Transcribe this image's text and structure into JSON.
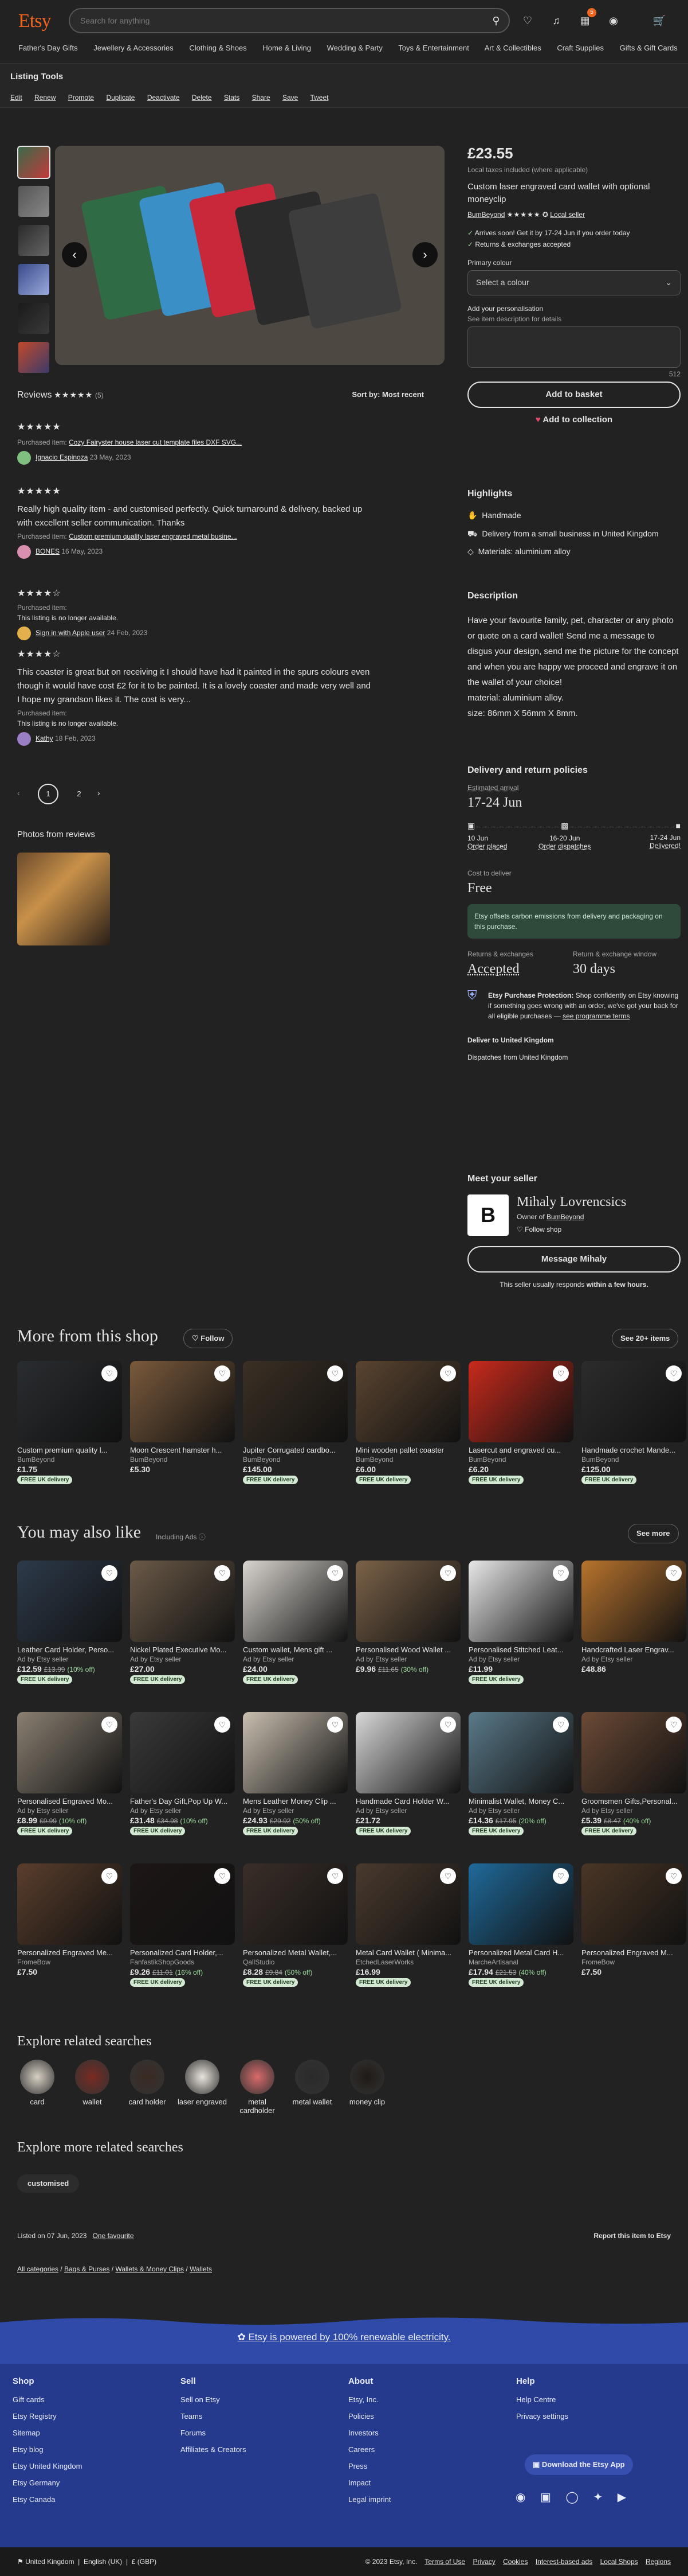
{
  "header": {
    "logo": "Etsy",
    "search_placeholder": "Search for anything",
    "cart_count": "5",
    "categories": [
      "Father's Day Gifts",
      "Jewellery & Accessories",
      "Clothing & Shoes",
      "Home & Living",
      "Wedding & Party",
      "Toys & Entertainment",
      "Art & Collectibles",
      "Craft Supplies",
      "Gifts & Gift Cards"
    ]
  },
  "tools": {
    "title": "Listing Tools",
    "actions": [
      "Edit",
      "Renew",
      "Promote",
      "Duplicate",
      "Deactivate",
      "Delete",
      "Stats",
      "Share",
      "Save",
      "Tweet"
    ]
  },
  "reviews": {
    "title": "Reviews",
    "count": "(5)",
    "sort_label": "Sort by: Most recent",
    "items": [
      {
        "stars": "★★★★★",
        "purchased_label": "Purchased item:",
        "item": "Cozy Fairyster house laser cut template files DXF SVG...",
        "author": "Ignacio Espinoza",
        "date": "23 May, 2023",
        "body": "",
        "avatar_color": "#7fbf7f"
      },
      {
        "stars": "★★★★★",
        "purchased_label": "Purchased item:",
        "item": "Custom premium quality laser engraved metal busine...",
        "author": "BONES",
        "date": "16 May, 2023",
        "body": "Really high quality item - and customised perfectly. Quick turnaround & delivery, backed up with excellent seller communication. Thanks",
        "avatar_color": "#d88fb0"
      },
      {
        "stars": "★★★★☆",
        "purchased_label": "Purchased item:",
        "item": "This listing is no longer available.",
        "author": "Sign in with Apple user",
        "date": "24 Feb, 2023",
        "body": "",
        "avatar_color": "#e3b04b"
      },
      {
        "stars": "★★★★☆",
        "purchased_label": "Purchased item:",
        "item": "This listing is no longer available.",
        "author": "Kathy",
        "date": "18 Feb, 2023",
        "body": "This coaster is great but on receiving it I should have had it painted in the spurs colours even though it would have cost £2 for it to be painted. It is a lovely coaster and made very well and I hope my grandson likes it. The cost is very...",
        "avatar_color": "#9a7fc4"
      }
    ],
    "pages": [
      "1",
      "2"
    ],
    "photos_title": "Photos from reviews"
  },
  "listing": {
    "price": "£23.55",
    "tax_note": "Local taxes included (where applicable)",
    "title": "Custom laser engraved card wallet with optional moneyclip",
    "shop": "BumBeyond",
    "stars": "★★★★★",
    "star_badge": "✪",
    "local_seller": "Local seller",
    "arrival": "Arrives soon! Get it by 17-24 Jun if you order today",
    "returns": "Returns & exchanges accepted",
    "option_label": "Primary colour",
    "option_value": "Select a colour",
    "personal_label": "Add your personalisation",
    "personal_hint": "See item description for details",
    "counter": "512",
    "add_basket": "Add to basket",
    "add_collection": "Add to collection"
  },
  "highlights": {
    "title": "Highlights",
    "items": [
      "Handmade",
      "Delivery from a small business in United Kingdom",
      "Materials: aluminium alloy"
    ]
  },
  "description": {
    "title": "Description",
    "text": "Have your favourite family, pet, character or any photo or quote on a card wallet! Send me a message to disgus your design, send me the picture for the concept and when you are happy we proceed and engrave it on the wallet of your choice!\nmaterial: aluminium alloy.\nsize: 86mm X 56mm X 8mm."
  },
  "delivery": {
    "title": "Delivery and return policies",
    "est_label": "Estimated arrival",
    "est": "17-24 Jun",
    "steps": [
      {
        "date": "10 Jun",
        "label": "Order placed"
      },
      {
        "date": "16-20 Jun",
        "label": "Order dispatches"
      },
      {
        "date": "17-24 Jun",
        "label": "Delivered!"
      }
    ],
    "cost_label": "Cost to deliver",
    "cost": "Free",
    "eco": "Etsy offsets carbon emissions from delivery and packaging on this purchase.",
    "re_label": "Returns & exchanges",
    "re_value": "Accepted",
    "window_label": "Return & exchange window",
    "window_value": "30 days",
    "protect_title": "Etsy Purchase Protection:",
    "protect_text": " Shop confidently on Etsy knowing if something goes wrong with an order, we've got your back for all eligible purchases —",
    "protect_link": "see programme terms",
    "deliver_to": "Deliver to United Kingdom",
    "dispatch_from": "Dispatches from United Kingdom"
  },
  "seller": {
    "title": "Meet your seller",
    "name": "Mihaly Lovrencsics",
    "owner_of": "Owner of",
    "shop": "BumBeyond",
    "follow": "Follow shop",
    "message": "Message Mihaly",
    "response": "This seller usually responds ",
    "response_bold": "within a few hours."
  },
  "more_shop": {
    "title": "More from this shop",
    "follow": "Follow",
    "see": "See 20+ items",
    "items": [
      {
        "title": "Custom premium quality l...",
        "shop": "BumBeyond",
        "price": "£1.75",
        "free": "FREE UK delivery",
        "color": "#2a2d30"
      },
      {
        "title": "Moon Crescent hamster h...",
        "shop": "BumBeyond",
        "price": "£5.30",
        "free": "",
        "color": "#7a5a3c"
      },
      {
        "title": "Jupiter Corrugated cardbo...",
        "shop": "BumBeyond",
        "price": "£145.00",
        "free": "FREE UK delivery",
        "color": "#3b3024"
      },
      {
        "title": "Mini wooden pallet coaster",
        "shop": "BumBeyond",
        "price": "£6.00",
        "free": "FREE UK delivery",
        "color": "#5a4430"
      },
      {
        "title": "Lasercut and engraved cu...",
        "shop": "BumBeyond",
        "price": "£6.20",
        "free": "FREE UK delivery",
        "color": "#c82a1c"
      },
      {
        "title": "Handmade crochet Mande...",
        "shop": "BumBeyond",
        "price": "£125.00",
        "free": "FREE UK delivery",
        "color": "#2c2c2c"
      }
    ]
  },
  "also_like": {
    "title": "You may also like",
    "ads_label": "Including Ads",
    "more": "See more",
    "items": [
      {
        "title": "Leather Card Holder, Perso...",
        "shop": "Ad by Etsy seller",
        "price": "£12.59",
        "was": "£13.99",
        "off": "(10% off)",
        "free": "FREE UK delivery",
        "color": "#2d3a4a"
      },
      {
        "title": "Nickel Plated Executive Mo...",
        "shop": "Ad by Etsy seller",
        "price": "£27.00",
        "was": "",
        "off": "",
        "free": "FREE UK delivery",
        "color": "#6b5a48"
      },
      {
        "title": "Custom wallet, Mens gift ...",
        "shop": "Ad by Etsy seller",
        "price": "£24.00",
        "was": "",
        "off": "",
        "free": "FREE UK delivery",
        "color": "#d9d5cf"
      },
      {
        "title": "Personalised Wood Wallet ...",
        "shop": "Ad by Etsy seller",
        "price": "£9.96",
        "was": "£11.65",
        "off": "(30% off)",
        "free": "",
        "color": "#7b6248"
      },
      {
        "title": "Personalised Stitched Leat...",
        "shop": "Ad by Etsy seller",
        "price": "£11.99",
        "was": "",
        "off": "",
        "free": "FREE UK delivery",
        "color": "#e8e8e8"
      },
      {
        "title": "Handcrafted Laser Engrav...",
        "shop": "Ad by Etsy seller",
        "price": "£48.86",
        "was": "",
        "off": "",
        "free": "",
        "color": "#b8742e"
      },
      {
        "title": "Personalised Engraved Mo...",
        "shop": "Ad by Etsy seller",
        "price": "£8.99",
        "was": "£9.99",
        "off": "(10% off)",
        "free": "FREE UK delivery",
        "color": "#8a8072"
      },
      {
        "title": "Father's Day Gift,Pop Up W...",
        "shop": "Ad by Etsy seller",
        "price": "£31.48",
        "was": "£34.98",
        "off": "(10% off)",
        "free": "FREE UK delivery",
        "color": "#3a3a3a"
      },
      {
        "title": "Mens Leather Money Clip ...",
        "shop": "Ad by Etsy seller",
        "price": "£24.93",
        "was": "£29.92",
        "off": "(50% off)",
        "free": "FREE UK delivery",
        "color": "#c9bfb0"
      },
      {
        "title": "Handmade Card Holder W...",
        "shop": "Ad by Etsy seller",
        "price": "£21.72",
        "was": "",
        "off": "",
        "free": "FREE UK delivery",
        "color": "#d8d8d8"
      },
      {
        "title": "Minimalist Wallet, Money C...",
        "shop": "Ad by Etsy seller",
        "price": "£14.36",
        "was": "£17.95",
        "off": "(20% off)",
        "free": "FREE UK delivery",
        "color": "#5a7a8a"
      },
      {
        "title": "Groomsmen Gifts,Personal...",
        "shop": "Ad by Etsy seller",
        "price": "£5.39",
        "was": "£8.47",
        "off": "(40% off)",
        "free": "FREE UK delivery",
        "color": "#6b4a36"
      },
      {
        "title": "Personalized Engraved Me...",
        "shop": "FromeBow",
        "price": "£7.50",
        "was": "",
        "off": "",
        "free": "",
        "color": "#5a3e2c"
      },
      {
        "title": "Personalized Card Holder,...",
        "shop": "FanfastikShopGoods",
        "price": "£9.26",
        "was": "£11.01",
        "off": "(16% off)",
        "free": "FREE UK delivery",
        "color": "#1d1616"
      },
      {
        "title": "Personalized Metal Wallet,...",
        "shop": "QallStudio",
        "price": "£8.28",
        "was": "£9.84",
        "off": "(50% off)",
        "free": "FREE UK delivery",
        "color": "#3a2e28"
      },
      {
        "title": "Metal Card Wallet ( Minima...",
        "shop": "EtchedLaserWorks",
        "price": "£16.99",
        "was": "",
        "off": "",
        "free": "FREE UK delivery",
        "color": "#4a3a2e"
      },
      {
        "title": "Personalized Metal Card H...",
        "shop": "MarcheArtisanal",
        "price": "£17.94",
        "was": "£21.53",
        "off": "(40% off)",
        "free": "FREE UK delivery",
        "color": "#1f6a9a"
      },
      {
        "title": "Personalized Engraved M...",
        "shop": "FromeBow",
        "price": "£7.50",
        "was": "",
        "off": "",
        "free": "",
        "color": "#4a3626"
      }
    ]
  },
  "explore": {
    "title": "Explore related searches",
    "items": [
      {
        "label": "card",
        "color": "#d8d0c4"
      },
      {
        "label": "wallet",
        "color": "#7a2a22"
      },
      {
        "label": "card holder",
        "color": "#3a2a22"
      },
      {
        "label": "laser engraved",
        "color": "#e9e4dc"
      },
      {
        "label": "metal cardholder",
        "color": "#d86a6a"
      },
      {
        "label": "metal wallet",
        "color": "#2a2a2a"
      },
      {
        "label": "money clip",
        "color": "#1f1a16"
      }
    ]
  },
  "explore_more": {
    "title": "Explore more related searches",
    "chips": [
      "customised"
    ]
  },
  "listed": {
    "text": "Listed on 07 Jun, 2023",
    "favs": "One favourite",
    "report": "Report this item to Etsy"
  },
  "breadcrumbs": [
    "All categories",
    "Bags & Purses",
    "Wallets & Money Clips",
    "Wallets"
  ],
  "banner": {
    "text": "Etsy is powered by 100% renewable electricity."
  },
  "footer": {
    "cols": [
      {
        "title": "Shop",
        "items": [
          "Gift cards",
          "Etsy Registry",
          "Sitemap",
          "Etsy blog",
          "Etsy United Kingdom",
          "Etsy Germany",
          "Etsy Canada"
        ]
      },
      {
        "title": "Sell",
        "items": [
          "Sell on Etsy",
          "Teams",
          "Forums",
          "Affiliates & Creators"
        ]
      },
      {
        "title": "About",
        "items": [
          "Etsy, Inc.",
          "Policies",
          "Investors",
          "Careers",
          "Press",
          "Impact",
          "Legal imprint"
        ]
      },
      {
        "title": "Help",
        "items": [
          "Help Centre",
          "Privacy settings"
        ]
      }
    ],
    "app": "Download the Etsy App"
  },
  "bottom": {
    "region": "United Kingdom",
    "lang": "English (UK)",
    "currency": "£ (GBP)",
    "copyright": "© 2023 Etsy, Inc.",
    "links": [
      "Terms of Use",
      "Privacy",
      "Cookies",
      "Interest-based ads",
      "Local Shops",
      "Regions"
    ]
  }
}
